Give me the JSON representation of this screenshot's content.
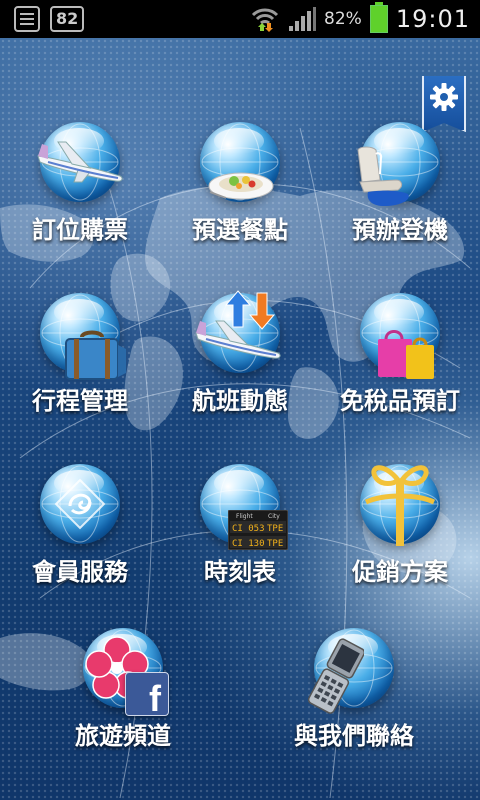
{
  "status_bar": {
    "notification_badge": "82",
    "battery_percent": "82%",
    "time": "19:01",
    "icons": [
      "notes-icon",
      "wifi-icon",
      "signal-icon",
      "battery-icon"
    ]
  },
  "settings": {
    "icon": "gear-icon"
  },
  "menu": {
    "booking": {
      "label": "訂位購票",
      "icon": "airplane-icon"
    },
    "meal": {
      "label": "預選餐點",
      "icon": "meal-plate-icon"
    },
    "checkin": {
      "label": "預辦登機",
      "icon": "airline-seat-icon"
    },
    "itinerary": {
      "label": "行程管理",
      "icon": "suitcase-icon"
    },
    "flight_status": {
      "label": "航班動態",
      "icon": "flight-status-icon"
    },
    "duty_free": {
      "label": "免稅品預訂",
      "icon": "shopping-bags-icon"
    },
    "member": {
      "label": "會員服務",
      "icon": "member-badge-icon"
    },
    "timetable": {
      "label": "時刻表",
      "icon": "departure-board-icon",
      "board_header": [
        "Flight",
        "City"
      ],
      "board_rows": [
        {
          "flight": "CI 053",
          "city": "TPE"
        },
        {
          "flight": "CI 130",
          "city": "TPE"
        }
      ]
    },
    "promotions": {
      "label": "促銷方案",
      "icon": "gift-icon"
    },
    "travel": {
      "label": "旅遊頻道",
      "icon": "plum-blossom-icon",
      "badge_icon": "facebook-icon",
      "badge_text": "f"
    },
    "contact": {
      "label": "與我們聯絡",
      "icon": "mobile-phone-icon"
    }
  },
  "colors": {
    "label_text": "#ffffff",
    "background_blue": "#123c70",
    "status_bar": "#000000",
    "battery_green": "#5fd12b",
    "orb_blue": "#4aaee8"
  }
}
